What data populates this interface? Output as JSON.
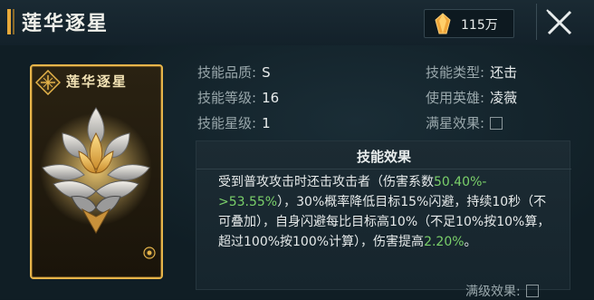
{
  "header": {
    "title": "莲华逐星",
    "currency_amount": "115万",
    "currency_icon": "crystal-gem-icon",
    "close_icon": "close-x-icon"
  },
  "card": {
    "name": "莲华逐星",
    "emblem_icon": "skill-emblem-icon",
    "art_icon": "golden-lotus-icon",
    "badge_icon": "corner-badge-icon"
  },
  "info": {
    "quality_label": "技能品质:",
    "quality_value": "S",
    "type_label": "技能类型:",
    "type_value": "还击",
    "level_label": "技能等级:",
    "level_value": "16",
    "hero_label": "使用英雄:",
    "hero_value": "凌薇",
    "star_label": "技能星级:",
    "star_value": "1",
    "full_star_label": "满星效果:"
  },
  "effect": {
    "title": "技能效果",
    "text_1": "受到普攻攻击时还击攻击者（伤害系数",
    "range": "50.40%->53.55%",
    "text_2": "），30%概率降低目标15%闪避，持续10秒（不可叠加），自身闪避每比目标高10%（不足10%按10%算，超过100%按100%计算），伤害提高",
    "bonus": "2.20%",
    "text_3": "。"
  },
  "footer": {
    "max_level_label": "满级效果:"
  },
  "colors": {
    "accent_gold": "#e6b44a",
    "highlight_green": "#7ad06a"
  }
}
